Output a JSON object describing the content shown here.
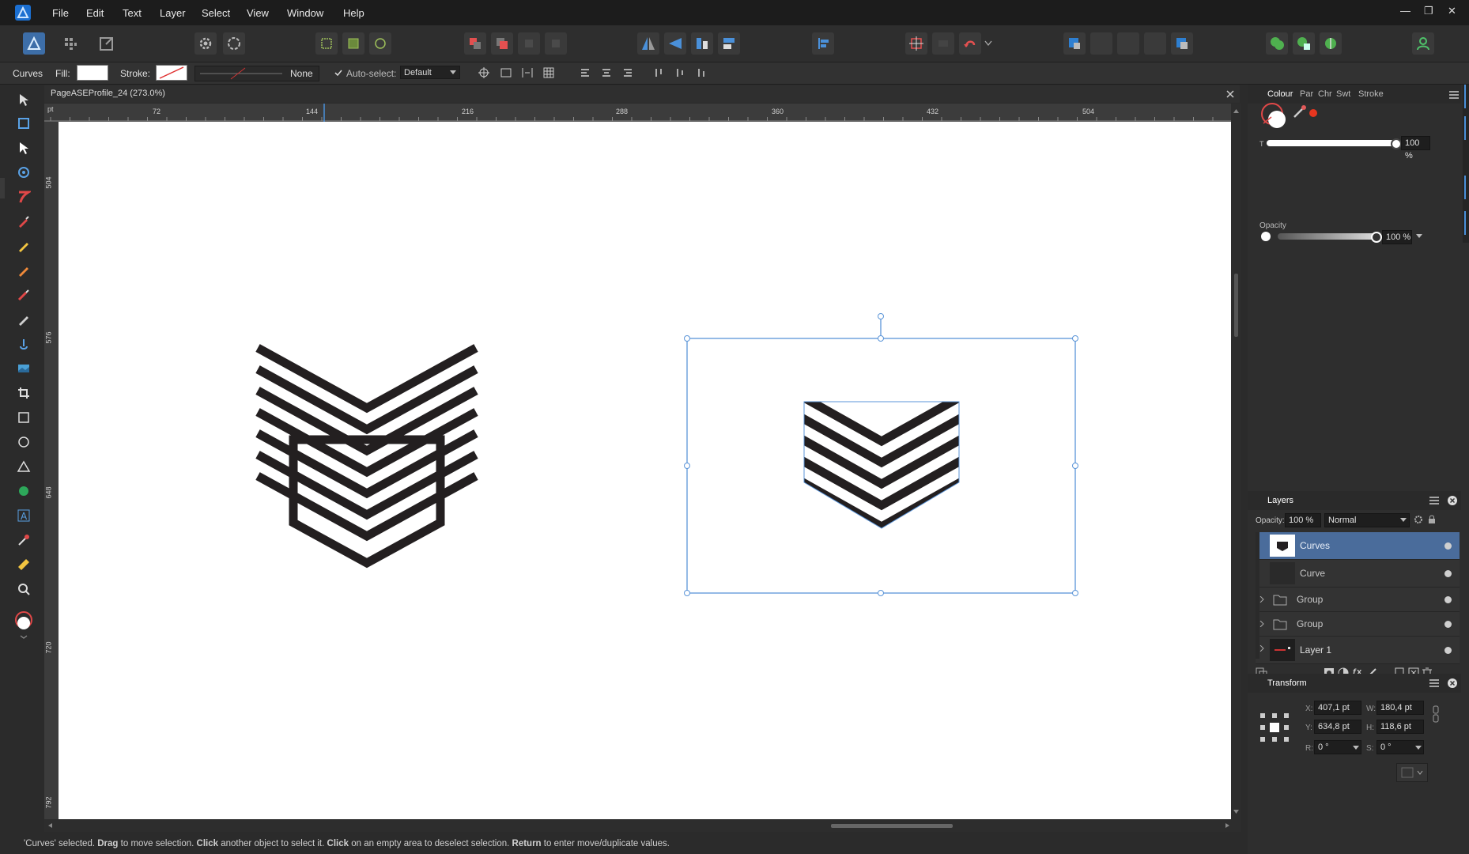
{
  "menubar": {
    "items": [
      "File",
      "Edit",
      "Text",
      "Layer",
      "Select",
      "View",
      "Window",
      "Help"
    ],
    "window_controls": [
      "—",
      "❐",
      "✕"
    ]
  },
  "context": {
    "tool_name": "Curves",
    "fill_label": "Fill:",
    "stroke_label": "Stroke:",
    "stroke_width_value": "None",
    "auto_select_label": "Auto-select:",
    "auto_select_value": "Default"
  },
  "document": {
    "tab_title": "PageASEProfile_24 (273.0%)",
    "ruler_unit": "pt",
    "ruler_top_ticks": [
      "72",
      "144",
      "216",
      "288",
      "360",
      "432",
      "504"
    ],
    "ruler_left_ticks": [
      "504",
      "576",
      "648",
      "720",
      "792"
    ]
  },
  "colour_panel": {
    "tabs": [
      "Colour",
      "Par",
      "Chr",
      "Swt",
      "Stroke"
    ],
    "t_label": "T",
    "t_value": "100 %",
    "opacity_label": "Opacity",
    "opacity_value": "100 %"
  },
  "layers_panel": {
    "title": "Layers",
    "opacity_label": "Opacity:",
    "opacity_value": "100 %",
    "blend_mode": "Normal",
    "rows": [
      {
        "name": "Curves",
        "selected": true
      },
      {
        "name": "Curve",
        "selected": false
      },
      {
        "name": "Group",
        "selected": false
      },
      {
        "name": "Group",
        "selected": false
      },
      {
        "name": "Layer 1",
        "selected": false
      }
    ]
  },
  "transform_panel": {
    "title": "Transform",
    "x_label": "X:",
    "x_value": "407,1 pt",
    "y_label": "Y:",
    "y_value": "634,8 pt",
    "w_label": "W:",
    "w_value": "180,4 pt",
    "h_label": "H:",
    "h_value": "118,6 pt",
    "r_label": "R:",
    "r_value": "0 °",
    "s_label": "S:",
    "s_value": "0 °"
  },
  "status": {
    "selected": "'Curves' selected.",
    "drag": "Drag",
    "drag_text": "to move selection.",
    "click": "Click",
    "click_text": "another object to select it.",
    "click2": "Click",
    "click2_text": "on an empty area to deselect selection.",
    "return": "Return",
    "return_text": "to enter move/duplicate values."
  },
  "colors": {
    "accent": "#4a90d9",
    "selection": "#5b95d8",
    "canvas": "#ffffff",
    "artwork": "#231f20",
    "layer_selected": "#4a6c9b"
  }
}
